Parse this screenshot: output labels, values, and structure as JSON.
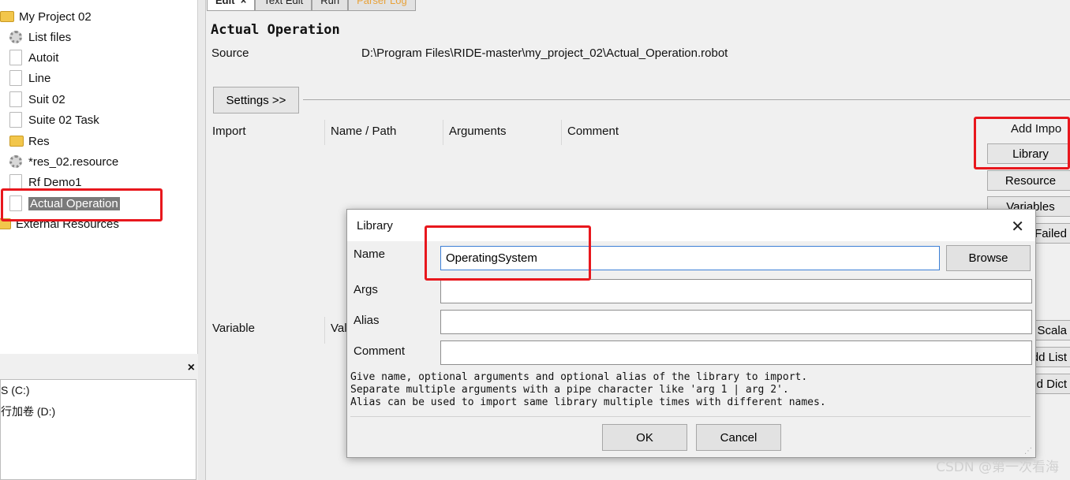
{
  "tree": {
    "items": [
      {
        "label": "My Project 02",
        "icon": "folder-icon",
        "selected": false
      },
      {
        "label": "List files",
        "icon": "gear-icon",
        "selected": false
      },
      {
        "label": "Autoit",
        "icon": "document-icon",
        "selected": false
      },
      {
        "label": "Line",
        "icon": "document-icon",
        "selected": false
      },
      {
        "label": "Suit 02",
        "icon": "document-icon",
        "selected": false
      },
      {
        "label": "Suite 02 Task",
        "icon": "document-icon",
        "selected": false
      },
      {
        "label": "Res",
        "icon": "folder-edit-icon",
        "selected": false
      },
      {
        "label": "*res_02.resource",
        "icon": "gear-icon",
        "selected": false
      },
      {
        "label": "Rf Demo1",
        "icon": "document-icon",
        "selected": false
      },
      {
        "label": "Actual Operation",
        "icon": "document-icon",
        "selected": true
      },
      {
        "label": "External Resources",
        "icon": "folder-icon",
        "selected": false
      }
    ]
  },
  "file_panel": {
    "close": "×",
    "drives": [
      "S (C:)",
      "行加卷 (D:)"
    ]
  },
  "tabs": [
    {
      "label": "Edit",
      "close": "×"
    },
    {
      "label": "Text Edit"
    },
    {
      "label": "Run"
    },
    {
      "label": "Parser Log"
    }
  ],
  "editor": {
    "title": "Actual Operation",
    "source_label": "Source",
    "source_path": "D:\\Program Files\\RIDE-master\\my_project_02\\Actual_Operation.robot",
    "settings_button": "Settings >>",
    "import_columns": [
      "Import",
      "Name / Path",
      "Arguments",
      "Comment"
    ],
    "add_import_label": "Add Impo",
    "import_buttons": [
      "Library",
      "Resource",
      "Variables",
      "Failed"
    ],
    "variable_columns": [
      "Variable",
      "Val"
    ],
    "variable_buttons": [
      "Scala",
      "dd List",
      "dd Dict"
    ]
  },
  "dialog": {
    "title": "Library",
    "close": "✕",
    "name_label": "Name",
    "name_value": "OperatingSystem",
    "browse_label": "Browse",
    "args_label": "Args",
    "args_value": "",
    "alias_label": "Alias",
    "alias_value": "",
    "comment_label": "Comment",
    "comment_value": "",
    "help_lines": [
      "Give name, optional arguments and optional alias of the library to import.",
      "Separate multiple arguments with a pipe character like 'arg 1 | arg 2'.",
      "Alias can be used to import same library multiple times with different names."
    ],
    "ok_label": "OK",
    "cancel_label": "Cancel"
  },
  "highlight_color": "#e8171d",
  "watermark": "CSDN @第一次看海"
}
